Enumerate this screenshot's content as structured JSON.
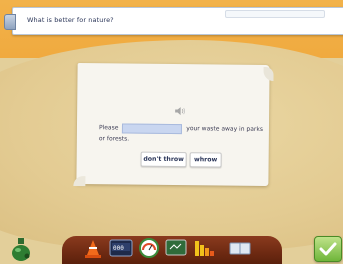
{
  "header": {
    "question": "What is better for nature?"
  },
  "exercise": {
    "sentence_before": "Please",
    "blank_value": "",
    "sentence_after": "your waste away in parks or forests.",
    "options": [
      {
        "label": "don't throw"
      },
      {
        "label": "whrow"
      }
    ]
  },
  "toolbar": {
    "icons": [
      "traffic-cone-icon",
      "calculator-icon",
      "gauge-icon",
      "blackboard-icon",
      "bar-chart-icon",
      "book-icon"
    ]
  },
  "colors": {
    "accent_green": "#6fb53a",
    "toolbar_brown": "#6e2a12",
    "blank_fill": "#c9d6f0"
  }
}
